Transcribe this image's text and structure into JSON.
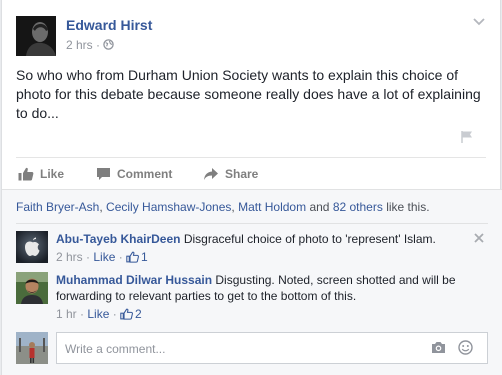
{
  "post": {
    "author": "Edward Hirst",
    "time": "2 hrs",
    "separator": "·",
    "text": "So who who from Durham Union Society wants to explain this choice of photo for this debate because someone really does have a lot of explaining to do..."
  },
  "actions": {
    "like": "Like",
    "comment": "Comment",
    "share": "Share"
  },
  "likes": {
    "names": [
      "Faith Bryer-Ash",
      "Cecily Hamshaw-Jones",
      "Matt Holdom"
    ],
    "comma": ", ",
    "and": " and ",
    "others": "82 others",
    "suffix": " like this."
  },
  "comments": [
    {
      "name": "Abu-Tayeb KhairDeen",
      "text": "Disgraceful choice of photo to 'represent' Islam.",
      "time": "2 hrs",
      "like_label": "Like",
      "like_count": "1"
    },
    {
      "name": "Muhammad Dilwar Hussain",
      "text": "Disgusting. Noted, screen shotted and will be forwarding to relevant parties to get to the bottom of this.",
      "time": "1 hr",
      "like_label": "Like",
      "like_count": "2"
    }
  ],
  "composer": {
    "placeholder": "Write a comment..."
  },
  "colors": {
    "link": "#365899",
    "muted": "#90949c",
    "action": "#7f7f7f",
    "feedback_bg": "#f6f7f9"
  }
}
